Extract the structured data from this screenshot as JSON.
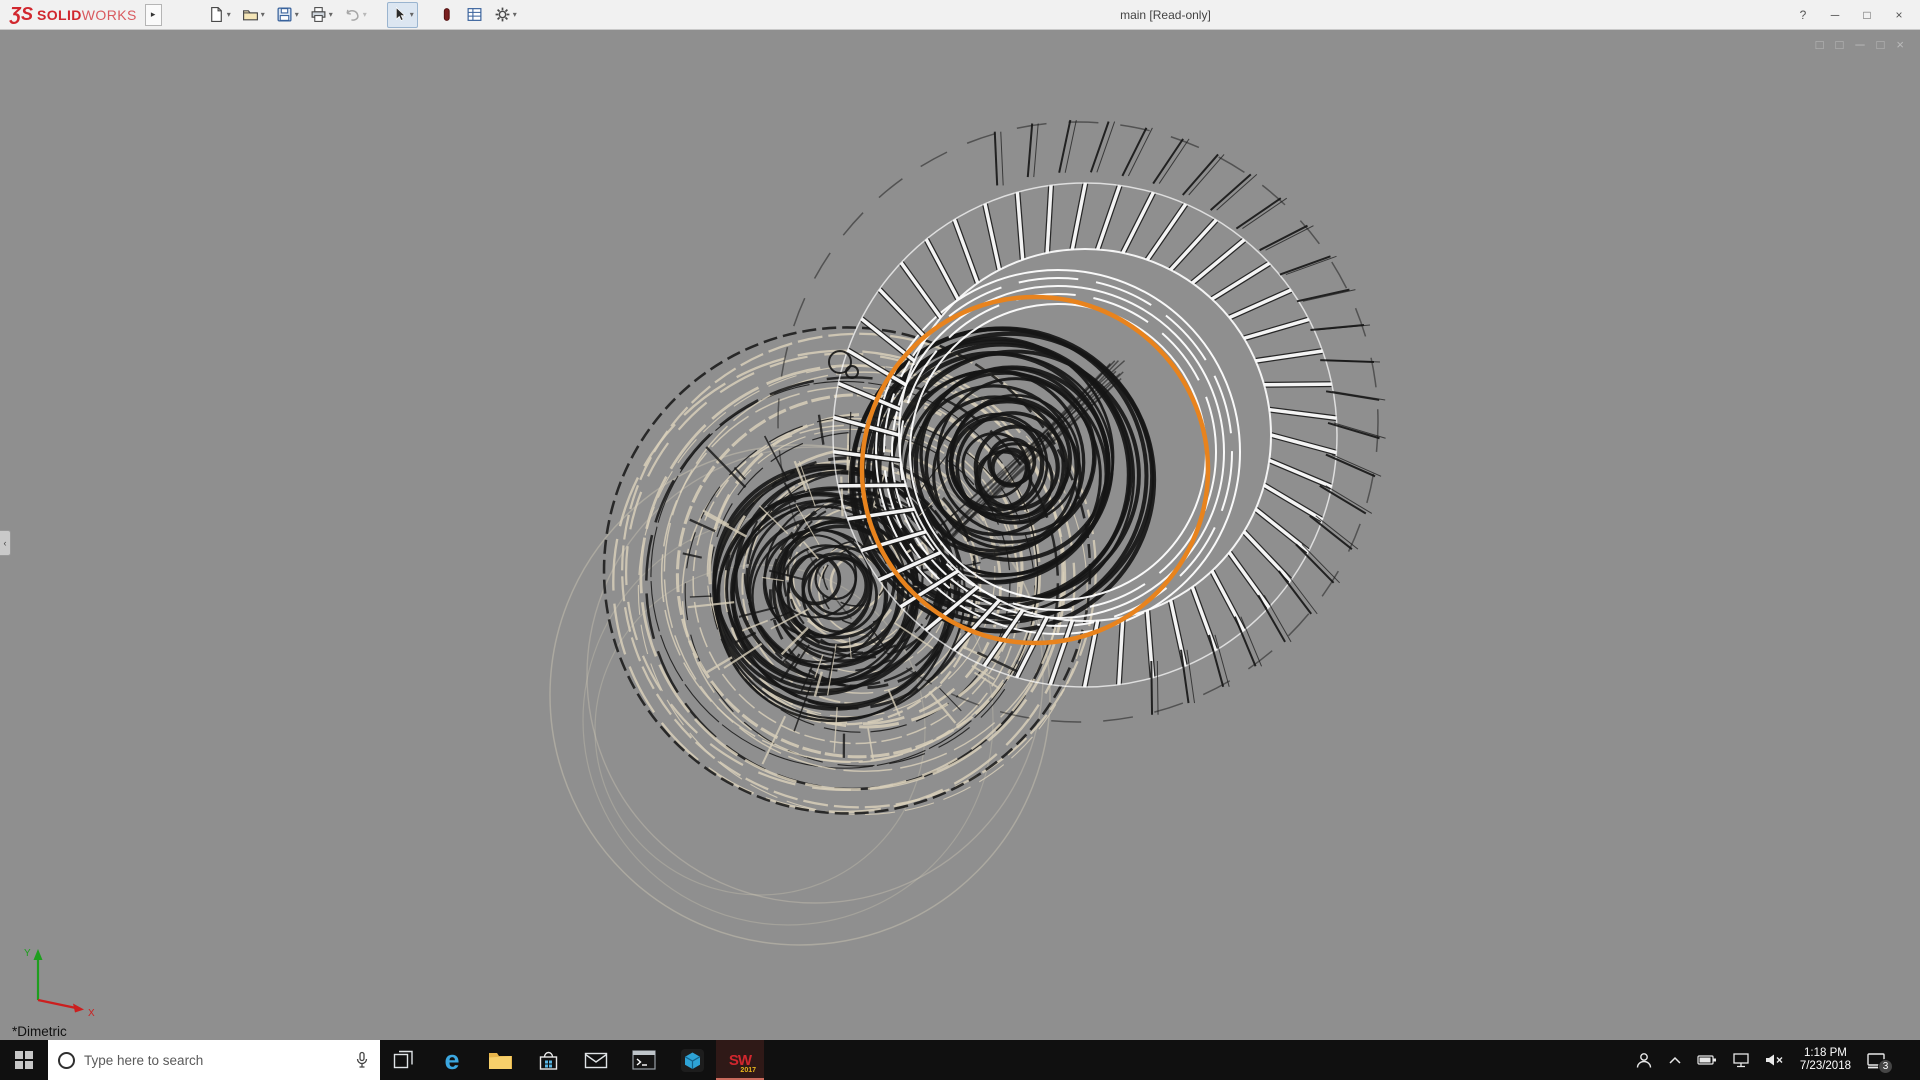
{
  "titlebar": {
    "brand": {
      "mark": "ƷS",
      "bold": "SOLID",
      "light": "WORKS"
    },
    "expand_label": "▸",
    "caret": "▾",
    "title": "main [Read-only]",
    "help_label": "?",
    "minimize_label": "─",
    "maximize_label": "□",
    "close_label": "×"
  },
  "toolbar": {
    "icons": [
      "new-document",
      "open",
      "save",
      "print",
      "undo",
      "select",
      "display-states",
      "file-properties",
      "options"
    ]
  },
  "viewport": {
    "background": "#8f8f8f",
    "view_label": "*Dimetric",
    "axis_x": "X",
    "axis_y": "Y",
    "highlight_color": "#E8831D",
    "wireframe_colors": {
      "dark": "#161616",
      "light": "#ffffff",
      "tan": "#d8cfba"
    },
    "mdi_controls": {
      "pane1": "□",
      "pane2": "□",
      "minimize": "─",
      "restore": "□",
      "close": "×"
    }
  },
  "taskbar": {
    "search": {
      "placeholder": "Type here to search"
    },
    "apps": [
      "task-view",
      "edge",
      "file-explorer",
      "store",
      "mail",
      "command-prompt",
      "composer",
      "solidworks-2017"
    ],
    "solidworks_badge": {
      "letters": "SW",
      "year": "2017"
    },
    "tray": {
      "time": "1:18 PM",
      "date": "7/23/2018",
      "notification_count": "3"
    }
  }
}
